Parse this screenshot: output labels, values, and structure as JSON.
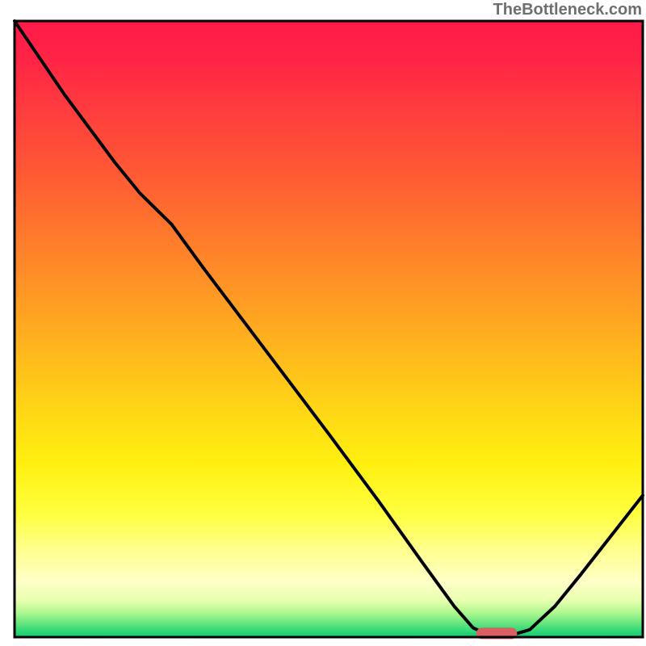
{
  "watermark": "TheBottleneck.com",
  "colors": {
    "gradient_stops": [
      {
        "offset": 0.0,
        "color": "#ff1a4a"
      },
      {
        "offset": 0.06,
        "color": "#ff2446"
      },
      {
        "offset": 0.15,
        "color": "#ff3e3e"
      },
      {
        "offset": 0.25,
        "color": "#ff5a34"
      },
      {
        "offset": 0.35,
        "color": "#ff7a2c"
      },
      {
        "offset": 0.45,
        "color": "#ff9a24"
      },
      {
        "offset": 0.55,
        "color": "#ffbc1c"
      },
      {
        "offset": 0.65,
        "color": "#ffdc14"
      },
      {
        "offset": 0.72,
        "color": "#fff010"
      },
      {
        "offset": 0.8,
        "color": "#ffff40"
      },
      {
        "offset": 0.86,
        "color": "#ffff90"
      },
      {
        "offset": 0.91,
        "color": "#ffffc8"
      },
      {
        "offset": 0.94,
        "color": "#e8ffb0"
      },
      {
        "offset": 0.96,
        "color": "#b0f890"
      },
      {
        "offset": 0.975,
        "color": "#70e880"
      },
      {
        "offset": 0.99,
        "color": "#30d878"
      },
      {
        "offset": 1.0,
        "color": "#10c870"
      }
    ],
    "curve": "#000000",
    "marker_fill": "#d86060",
    "frame": "#000000",
    "watermark": "#6f6f6f"
  },
  "chart_data": {
    "type": "line",
    "title": "",
    "xlabel": "",
    "ylabel": "",
    "xlim": [
      0,
      100
    ],
    "ylim": [
      0,
      100
    ],
    "curve_points": [
      {
        "x": 0.0,
        "y": 100.0
      },
      {
        "x": 8.0,
        "y": 88.0
      },
      {
        "x": 16.0,
        "y": 77.0
      },
      {
        "x": 20.0,
        "y": 72.0
      },
      {
        "x": 25.0,
        "y": 67.0
      },
      {
        "x": 30.0,
        "y": 60.0
      },
      {
        "x": 40.0,
        "y": 46.5
      },
      {
        "x": 50.0,
        "y": 33.0
      },
      {
        "x": 58.0,
        "y": 22.0
      },
      {
        "x": 65.0,
        "y": 12.0
      },
      {
        "x": 70.0,
        "y": 5.0
      },
      {
        "x": 73.0,
        "y": 1.5
      },
      {
        "x": 75.0,
        "y": 0.6
      },
      {
        "x": 78.0,
        "y": 0.6
      },
      {
        "x": 80.0,
        "y": 0.6
      },
      {
        "x": 82.0,
        "y": 1.2
      },
      {
        "x": 86.0,
        "y": 5.0
      },
      {
        "x": 90.0,
        "y": 10.0
      },
      {
        "x": 95.0,
        "y": 16.5
      },
      {
        "x": 100.0,
        "y": 23.0
      }
    ],
    "marker": {
      "x_start": 73.5,
      "x_end": 80.0,
      "y": 0.6
    }
  }
}
